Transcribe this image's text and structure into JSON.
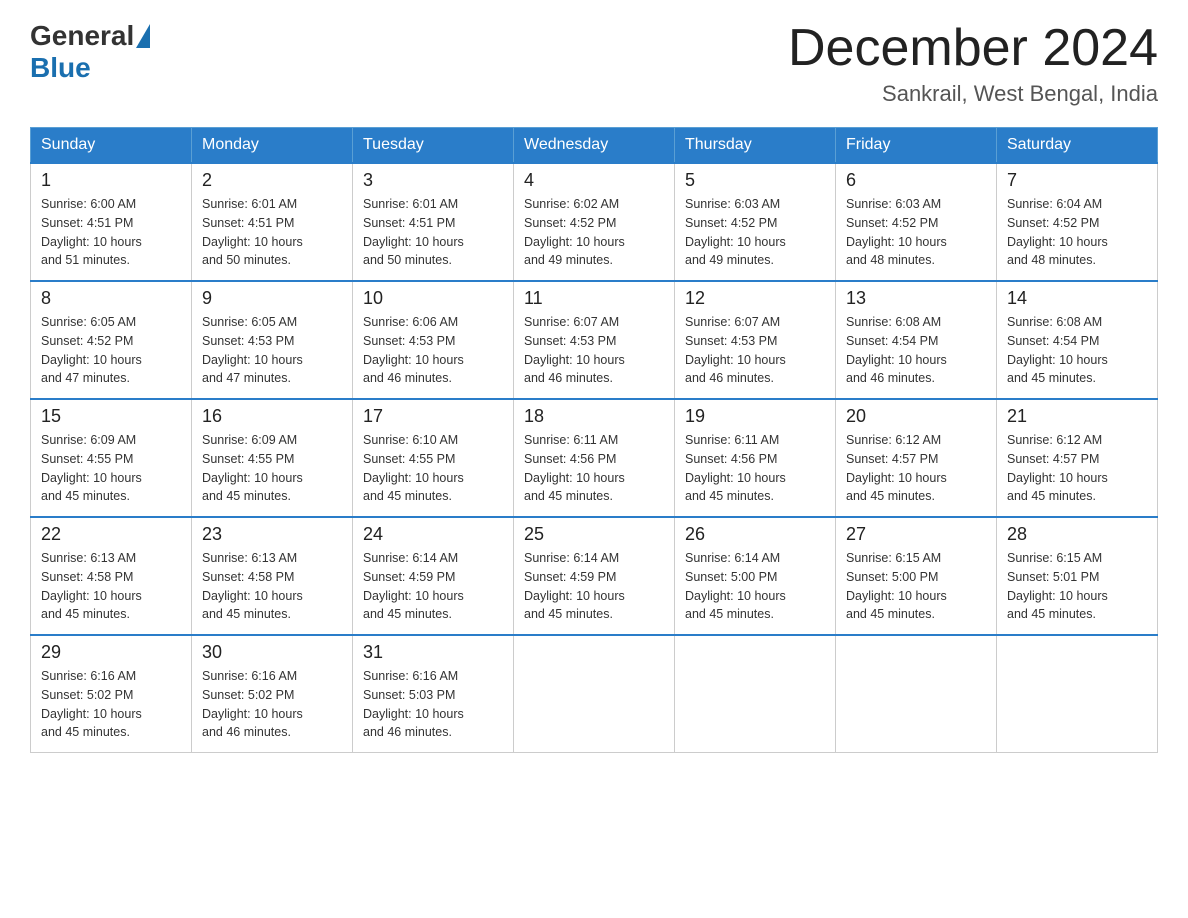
{
  "header": {
    "logo_general": "General",
    "logo_blue": "Blue",
    "month_title": "December 2024",
    "location": "Sankrail, West Bengal, India"
  },
  "days_of_week": [
    "Sunday",
    "Monday",
    "Tuesday",
    "Wednesday",
    "Thursday",
    "Friday",
    "Saturday"
  ],
  "weeks": [
    [
      {
        "day": "1",
        "sunrise": "6:00 AM",
        "sunset": "4:51 PM",
        "daylight": "10 hours and 51 minutes."
      },
      {
        "day": "2",
        "sunrise": "6:01 AM",
        "sunset": "4:51 PM",
        "daylight": "10 hours and 50 minutes."
      },
      {
        "day": "3",
        "sunrise": "6:01 AM",
        "sunset": "4:51 PM",
        "daylight": "10 hours and 50 minutes."
      },
      {
        "day": "4",
        "sunrise": "6:02 AM",
        "sunset": "4:52 PM",
        "daylight": "10 hours and 49 minutes."
      },
      {
        "day": "5",
        "sunrise": "6:03 AM",
        "sunset": "4:52 PM",
        "daylight": "10 hours and 49 minutes."
      },
      {
        "day": "6",
        "sunrise": "6:03 AM",
        "sunset": "4:52 PM",
        "daylight": "10 hours and 48 minutes."
      },
      {
        "day": "7",
        "sunrise": "6:04 AM",
        "sunset": "4:52 PM",
        "daylight": "10 hours and 48 minutes."
      }
    ],
    [
      {
        "day": "8",
        "sunrise": "6:05 AM",
        "sunset": "4:52 PM",
        "daylight": "10 hours and 47 minutes."
      },
      {
        "day": "9",
        "sunrise": "6:05 AM",
        "sunset": "4:53 PM",
        "daylight": "10 hours and 47 minutes."
      },
      {
        "day": "10",
        "sunrise": "6:06 AM",
        "sunset": "4:53 PM",
        "daylight": "10 hours and 46 minutes."
      },
      {
        "day": "11",
        "sunrise": "6:07 AM",
        "sunset": "4:53 PM",
        "daylight": "10 hours and 46 minutes."
      },
      {
        "day": "12",
        "sunrise": "6:07 AM",
        "sunset": "4:53 PM",
        "daylight": "10 hours and 46 minutes."
      },
      {
        "day": "13",
        "sunrise": "6:08 AM",
        "sunset": "4:54 PM",
        "daylight": "10 hours and 46 minutes."
      },
      {
        "day": "14",
        "sunrise": "6:08 AM",
        "sunset": "4:54 PM",
        "daylight": "10 hours and 45 minutes."
      }
    ],
    [
      {
        "day": "15",
        "sunrise": "6:09 AM",
        "sunset": "4:55 PM",
        "daylight": "10 hours and 45 minutes."
      },
      {
        "day": "16",
        "sunrise": "6:09 AM",
        "sunset": "4:55 PM",
        "daylight": "10 hours and 45 minutes."
      },
      {
        "day": "17",
        "sunrise": "6:10 AM",
        "sunset": "4:55 PM",
        "daylight": "10 hours and 45 minutes."
      },
      {
        "day": "18",
        "sunrise": "6:11 AM",
        "sunset": "4:56 PM",
        "daylight": "10 hours and 45 minutes."
      },
      {
        "day": "19",
        "sunrise": "6:11 AM",
        "sunset": "4:56 PM",
        "daylight": "10 hours and 45 minutes."
      },
      {
        "day": "20",
        "sunrise": "6:12 AM",
        "sunset": "4:57 PM",
        "daylight": "10 hours and 45 minutes."
      },
      {
        "day": "21",
        "sunrise": "6:12 AM",
        "sunset": "4:57 PM",
        "daylight": "10 hours and 45 minutes."
      }
    ],
    [
      {
        "day": "22",
        "sunrise": "6:13 AM",
        "sunset": "4:58 PM",
        "daylight": "10 hours and 45 minutes."
      },
      {
        "day": "23",
        "sunrise": "6:13 AM",
        "sunset": "4:58 PM",
        "daylight": "10 hours and 45 minutes."
      },
      {
        "day": "24",
        "sunrise": "6:14 AM",
        "sunset": "4:59 PM",
        "daylight": "10 hours and 45 minutes."
      },
      {
        "day": "25",
        "sunrise": "6:14 AM",
        "sunset": "4:59 PM",
        "daylight": "10 hours and 45 minutes."
      },
      {
        "day": "26",
        "sunrise": "6:14 AM",
        "sunset": "5:00 PM",
        "daylight": "10 hours and 45 minutes."
      },
      {
        "day": "27",
        "sunrise": "6:15 AM",
        "sunset": "5:00 PM",
        "daylight": "10 hours and 45 minutes."
      },
      {
        "day": "28",
        "sunrise": "6:15 AM",
        "sunset": "5:01 PM",
        "daylight": "10 hours and 45 minutes."
      }
    ],
    [
      {
        "day": "29",
        "sunrise": "6:16 AM",
        "sunset": "5:02 PM",
        "daylight": "10 hours and 45 minutes."
      },
      {
        "day": "30",
        "sunrise": "6:16 AM",
        "sunset": "5:02 PM",
        "daylight": "10 hours and 46 minutes."
      },
      {
        "day": "31",
        "sunrise": "6:16 AM",
        "sunset": "5:03 PM",
        "daylight": "10 hours and 46 minutes."
      },
      null,
      null,
      null,
      null
    ]
  ],
  "labels": {
    "sunrise": "Sunrise:",
    "sunset": "Sunset:",
    "daylight": "Daylight:"
  }
}
